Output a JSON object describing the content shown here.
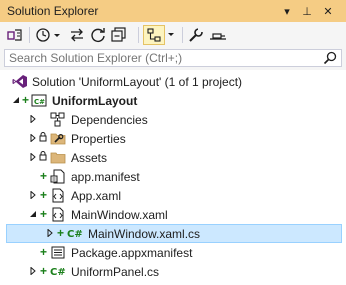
{
  "window": {
    "title": "Solution Explorer"
  },
  "title_controls": {
    "dropdown": "▾",
    "pin": "⊥",
    "close": "✕"
  },
  "search": {
    "placeholder": "Search Solution Explorer (Ctrl+;)"
  },
  "tree": {
    "solution": "Solution 'UniformLayout' (1 of 1 project)",
    "project": "UniformLayout",
    "dependencies": "Dependencies",
    "properties": "Properties",
    "assets": "Assets",
    "app_manifest": "app.manifest",
    "app_xaml": "App.xaml",
    "main_window": "MainWindow.xaml",
    "main_window_cs": "MainWindow.xaml.cs",
    "package_manifest": "Package.appxmanifest",
    "uniform_panel": "UniformPanel.cs"
  },
  "colors": {
    "title_bar": "#f5cc84",
    "selection": "#cce8ff",
    "csharp_green": "#1a7f1a",
    "vs_purple": "#68217a"
  }
}
